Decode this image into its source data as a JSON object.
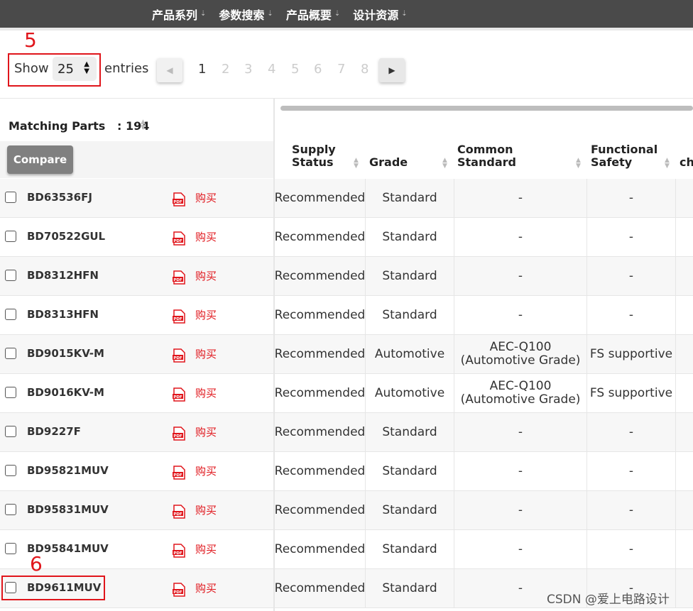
{
  "nav": {
    "items": [
      {
        "label": "产品系列"
      },
      {
        "label": "参数搜索"
      },
      {
        "label": "产品概要"
      },
      {
        "label": "设计资源"
      }
    ]
  },
  "annotations": {
    "step5": "5",
    "step6": "6"
  },
  "length": {
    "show_label": "Show",
    "value": "25",
    "entries_label": "entries"
  },
  "pager": {
    "pages": [
      "1",
      "2",
      "3",
      "4",
      "5",
      "6",
      "7",
      "8"
    ],
    "current": "1"
  },
  "matching": {
    "label": "Matching Parts",
    "count": ": 194"
  },
  "compare_label": "Compare",
  "columns": {
    "supply": "Supply Status",
    "grade": "Grade",
    "common": "Common Standard",
    "functional": "Functional Safety",
    "next": "ch"
  },
  "buy_label": "购买",
  "rows": [
    {
      "part": "BD63536FJ",
      "supply": "Recommended",
      "grade": "Standard",
      "common": "-",
      "fs": "-"
    },
    {
      "part": "BD70522GUL",
      "supply": "Recommended",
      "grade": "Standard",
      "common": "-",
      "fs": "-"
    },
    {
      "part": "BD8312HFN",
      "supply": "Recommended",
      "grade": "Standard",
      "common": "-",
      "fs": "-"
    },
    {
      "part": "BD8313HFN",
      "supply": "Recommended",
      "grade": "Standard",
      "common": "-",
      "fs": "-"
    },
    {
      "part": "BD9015KV-M",
      "supply": "Recommended",
      "grade": "Automotive",
      "common": "AEC-Q100\n(Automotive Grade)",
      "fs": "FS supportive"
    },
    {
      "part": "BD9016KV-M",
      "supply": "Recommended",
      "grade": "Automotive",
      "common": "AEC-Q100\n(Automotive Grade)",
      "fs": "FS supportive"
    },
    {
      "part": "BD9227F",
      "supply": "Recommended",
      "grade": "Standard",
      "common": "-",
      "fs": "-"
    },
    {
      "part": "BD95821MUV",
      "supply": "Recommended",
      "grade": "Standard",
      "common": "-",
      "fs": "-"
    },
    {
      "part": "BD95831MUV",
      "supply": "Recommended",
      "grade": "Standard",
      "common": "-",
      "fs": "-"
    },
    {
      "part": "BD95841MUV",
      "supply": "Recommended",
      "grade": "Standard",
      "common": "-",
      "fs": "-"
    },
    {
      "part": "BD9611MUV",
      "supply": "Recommended",
      "grade": "Standard",
      "common": "-",
      "fs": "-"
    }
  ],
  "watermark": "CSDN @爱上电路设计",
  "colors": {
    "annotation": "#e0151b",
    "nav_bg": "#4a4a4a",
    "buy": "#e0151b"
  }
}
